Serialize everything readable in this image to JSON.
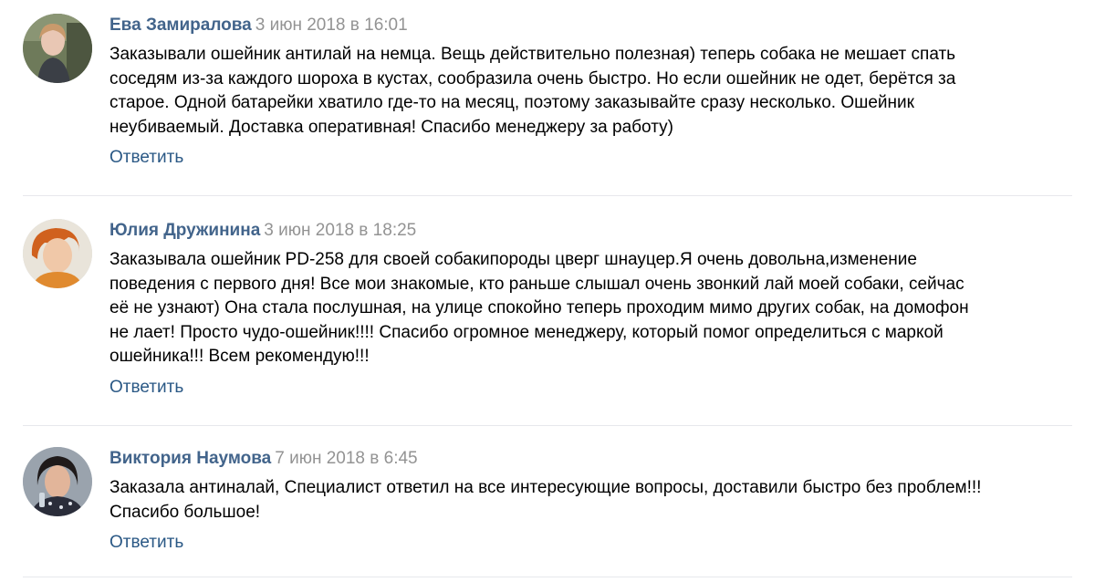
{
  "comments": [
    {
      "author": "Ева Замиралова",
      "date": "3 июн 2018 в 16:01",
      "text": "Заказывали ошейник антилай на немца. Вещь действительно полезная) теперь собака не мешает спать\nсоседям из-за каждого шороха в кустах, сообразила очень быстро. Но если ошейник не одет, берётся за\nстарое. Одной батарейки хватило где-то на месяц, поэтому заказывайте сразу несколько. Ошейник\nнеубиваемый. Доставка оперативная! Спасибо менеджеру за работу)",
      "reply_label": "Ответить"
    },
    {
      "author": "Юлия Дружинина",
      "date": "3 июн 2018 в 18:25",
      "text": "Заказывала ошейник PD-258 для своей собакипороды цверг шнауцер.Я очень довольна,изменение\nповедения с первого дня! Все мои знакомые, кто раньше слышал очень звонкий лай моей собаки, сейчас\nеё не узнают) Она стала послушная, на улице спокойно теперь проходим мимо других собак, на домофон\nне лает! Просто чудо-ошейник!!!! Спасибо огромное менеджеру, который помог определиться с маркой\nошейника!!! Всем рекомендую!!!",
      "reply_label": "Ответить"
    },
    {
      "author": "Виктория Наумова",
      "date": "7 июн 2018 в 6:45",
      "text": "Заказала антиналай, Специалист ответил на все интересующие вопросы, доставили быстро без проблем!!!\nСпасибо большое!",
      "reply_label": "Ответить"
    }
  ]
}
